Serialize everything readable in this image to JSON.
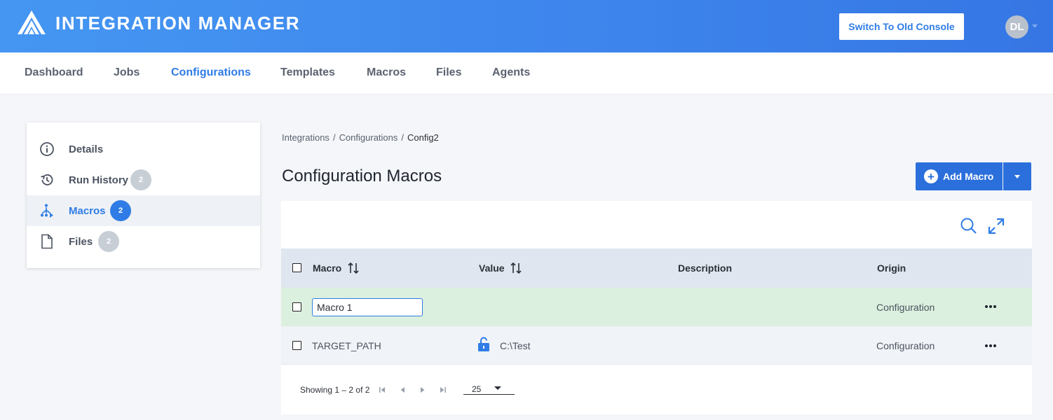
{
  "header": {
    "app_title": "INTEGRATION MANAGER",
    "switch_button": "Switch To Old Console",
    "avatar_initials": "DL"
  },
  "nav": {
    "items": [
      {
        "label": "Dashboard",
        "active": false
      },
      {
        "label": "Jobs",
        "active": false
      },
      {
        "label": "Configurations",
        "active": true
      },
      {
        "label": "Templates",
        "active": false
      },
      {
        "label": "Macros",
        "active": false
      },
      {
        "label": "Files",
        "active": false
      },
      {
        "label": "Agents",
        "active": false
      }
    ]
  },
  "sidebar": {
    "items": [
      {
        "label": "Details",
        "icon": "info-icon",
        "badge": null,
        "active": false
      },
      {
        "label": "Run History",
        "icon": "history-icon",
        "badge": "2",
        "active": false
      },
      {
        "label": "Macros",
        "icon": "macros-icon",
        "badge": "2",
        "active": true
      },
      {
        "label": "Files",
        "icon": "file-icon",
        "badge": "2",
        "active": false
      }
    ]
  },
  "breadcrumb": {
    "items": [
      "Integrations",
      "Configurations"
    ],
    "current": "Config2"
  },
  "page": {
    "title": "Configuration Macros",
    "add_button": "Add Macro"
  },
  "table": {
    "columns": [
      "Macro",
      "Value",
      "Description",
      "Origin"
    ],
    "rows": [
      {
        "macro": "Macro 1",
        "value": "",
        "description": "",
        "origin": "Configuration",
        "editing": true
      },
      {
        "macro": "TARGET_PATH",
        "value": "C:\\Test",
        "description": "",
        "origin": "Configuration",
        "editing": false,
        "value_icon": "unlock-icon"
      }
    ]
  },
  "pager": {
    "showing": "Showing 1 – 2 of 2",
    "per_page": "25"
  },
  "colors": {
    "accent": "#2f7ce6",
    "header_start": "#4596f2",
    "header_end": "#3576e4",
    "editing_row": "#dbf0de"
  }
}
